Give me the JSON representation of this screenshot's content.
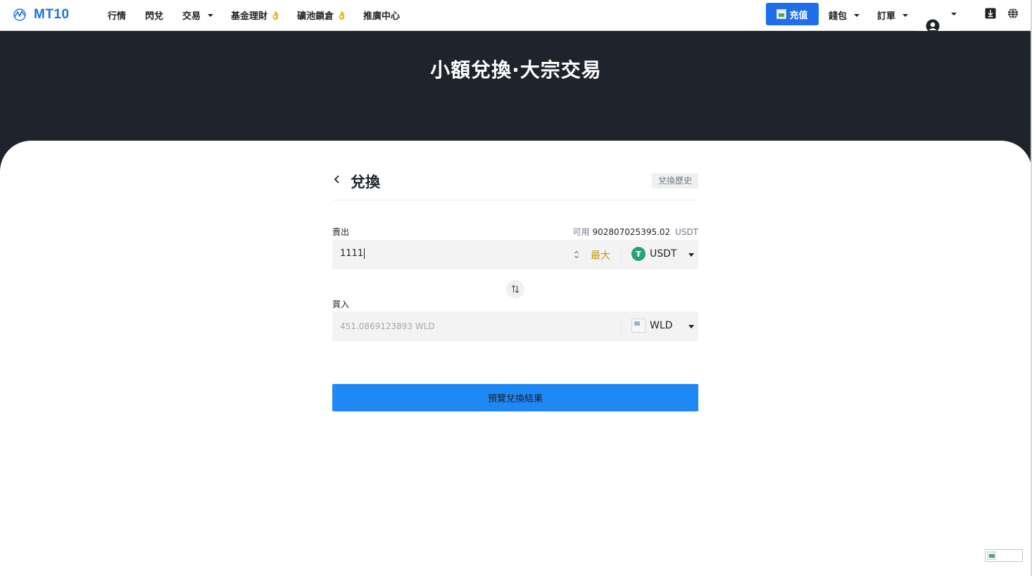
{
  "brand": {
    "name": "MT10",
    "logo_icon": "wave-logo-icon"
  },
  "nav": {
    "items": [
      {
        "label": "行情"
      },
      {
        "label": "閃兌"
      },
      {
        "label": "交易",
        "dropdown": true
      },
      {
        "label": "基金理財",
        "badge": "👌"
      },
      {
        "label": "礦池鎖倉",
        "badge": "👌"
      },
      {
        "label": "推廣中心"
      }
    ],
    "deposit_label": "充值",
    "wallet_label": "錢包",
    "orders_label": "訂單"
  },
  "hero": {
    "title": "小額兌換·大宗交易"
  },
  "exchange": {
    "title": "兌換",
    "history_label": "兌換歷史",
    "sell_label": "賣出",
    "available_prefix": "可用",
    "available_amount": "902807025395.02",
    "available_unit": "USDT",
    "sell_value": "1111",
    "max_label": "最大",
    "sell_coin": "USDT",
    "buy_label": "買入",
    "buy_placeholder": "451.0869123893 WLD",
    "buy_coin": "WLD",
    "preview_label": "預覽兌換結果"
  },
  "colors": {
    "accent": "#1f6feb",
    "hero_bg": "#1f232b",
    "button": "#1e88f7",
    "max": "#c99400",
    "usdt": "#26a17b"
  }
}
